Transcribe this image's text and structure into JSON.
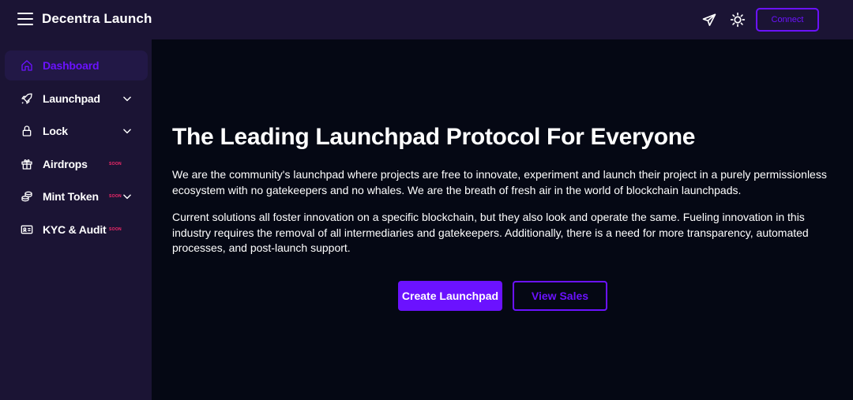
{
  "header": {
    "title": "Decentra Launch",
    "connect_label": "Connect",
    "icons": [
      "menu-icon",
      "telegram-icon",
      "sun-icon"
    ]
  },
  "sidebar": {
    "items": [
      {
        "label": "Dashboard",
        "icon": "home-icon",
        "active": true
      },
      {
        "label": "Launchpad",
        "icon": "rocket-icon",
        "expandable": true
      },
      {
        "label": "Lock",
        "icon": "lock-icon",
        "expandable": true
      },
      {
        "label": "Airdrops",
        "icon": "gift-icon",
        "badge": "SOON"
      },
      {
        "label": "Mint Token",
        "icon": "coins-icon",
        "badge": "SOON",
        "expandable": true
      },
      {
        "label": "KYC & Audit",
        "icon": "id-card-icon",
        "badge": "SOON"
      }
    ]
  },
  "main": {
    "headline": "The Leading Launchpad Protocol For Everyone",
    "paragraph1": "We are the community's launchpad where projects are free to innovate, experiment and launch their project in a purely permissionless ecosystem with no gatekeepers and no whales. We are the breath of fresh air in the world of blockchain launchpads.",
    "paragraph2": "Current solutions all foster innovation on a specific blockchain, but they also look and operate the same. Fueling innovation in this industry requires the removal of all intermediaries and gatekeepers. Additionally, there is a need for more transparency, automated processes, and post-launch support.",
    "primary_button": "Create Launchpad",
    "secondary_button": "View Sales"
  },
  "colors": {
    "accent": "#6b12ff",
    "sidebar_bg": "#1b1434",
    "main_bg": "#050814",
    "badge": "#ff2a6d"
  }
}
